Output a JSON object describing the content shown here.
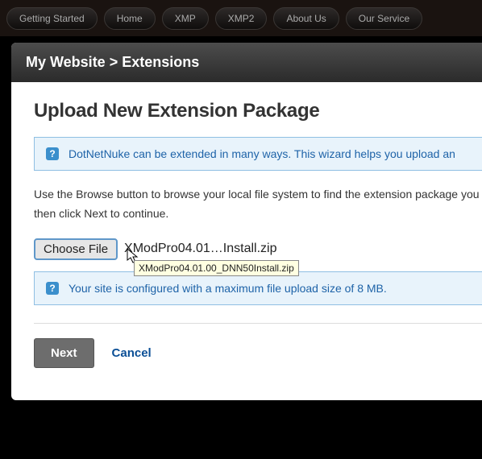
{
  "nav": {
    "items": [
      "Getting Started",
      "Home",
      "XMP",
      "XMP2",
      "About Us",
      "Our Service"
    ]
  },
  "breadcrumb": "My Website > Extensions",
  "title": "Upload New Extension Package",
  "info1": "DotNetNuke can be extended in many ways. This wizard helps you upload an",
  "instruction": "Use the Browse button to browse your local file system to find the extension package you wish to install, then click Next to continue.",
  "file": {
    "button_label": "Choose File",
    "selected_display": "XModPro04.01…Install.zip",
    "full_name": "XModPro04.01.00_DNN50Install.zip"
  },
  "info2": "Your site is configured with a maximum file upload size of 8 MB.",
  "actions": {
    "next": "Next",
    "cancel": "Cancel"
  },
  "icons": {
    "info_glyph": "?"
  }
}
